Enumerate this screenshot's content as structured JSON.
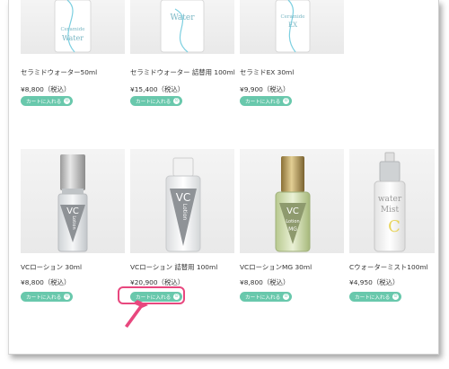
{
  "cart_label": "カートに入れる",
  "accent_color": "#69c8ac",
  "highlight_color": "#e8477e",
  "row1": [
    {
      "name": "セラミドウォーター50ml",
      "price": "¥8,800（税込）",
      "bottle_text": [
        "Ceramide",
        "Water"
      ]
    },
    {
      "name": "セラミドウォーター 詰替用 100ml",
      "price": "¥15,400（税込）",
      "bottle_text": [
        "Water"
      ]
    },
    {
      "name": "セラミドEX 30ml",
      "price": "¥9,900（税込）",
      "bottle_text": [
        "Ceramide",
        "EX"
      ]
    }
  ],
  "row2": [
    {
      "name": "VCローション 30ml",
      "price": "¥8,800（税込）",
      "bottle_text": [
        "VC",
        "Lotion"
      ]
    },
    {
      "name": "VCローション 詰替用 100ml",
      "price": "¥20,900（税込）",
      "bottle_text": [
        "VC",
        "Lotion"
      ]
    },
    {
      "name": "VCローションMG 30ml",
      "price": "¥8,800（税込）",
      "bottle_text": [
        "VC",
        "Lotion",
        "MG"
      ]
    },
    {
      "name": "Cウォーターミスト100ml",
      "price": "¥4,950（税込）",
      "bottle_text": [
        "water",
        "Mist",
        "C"
      ]
    }
  ]
}
